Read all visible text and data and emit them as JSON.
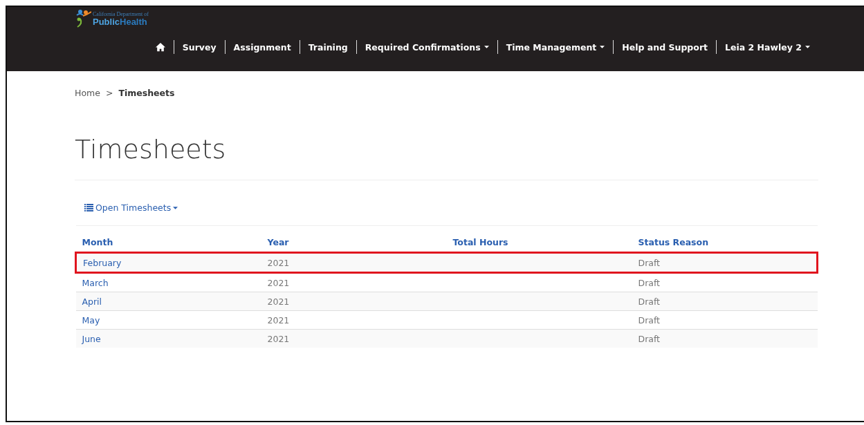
{
  "logo": {
    "subtitle": "California Department of",
    "title_part1": "Public",
    "title_part2": "Health"
  },
  "nav": [
    {
      "kind": "home"
    },
    {
      "kind": "link",
      "label": "Survey"
    },
    {
      "kind": "link",
      "label": "Assignment"
    },
    {
      "kind": "link",
      "label": "Training"
    },
    {
      "kind": "dropdown",
      "label": "Required Confirmations"
    },
    {
      "kind": "dropdown",
      "label": "Time Management"
    },
    {
      "kind": "link",
      "label": "Help and Support"
    },
    {
      "kind": "dropdown",
      "label": "Leia 2 Hawley 2"
    }
  ],
  "breadcrumb": [
    {
      "label": "Home",
      "current": false
    },
    {
      "label": "Timesheets",
      "current": true
    }
  ],
  "breadcrumb_separator": ">",
  "page_title": "Timesheets",
  "view_selector": {
    "label": "Open Timesheets"
  },
  "table": {
    "columns": [
      "Month",
      "Year",
      "Total Hours",
      "Status Reason"
    ],
    "rows": [
      {
        "month": "February",
        "year": "2021",
        "status": "Draft",
        "highlighted": true
      },
      {
        "month": "March",
        "year": "2021",
        "status": "Draft",
        "highlighted": false
      },
      {
        "month": "April",
        "year": "2021",
        "status": "Draft",
        "highlighted": false
      },
      {
        "month": "May",
        "year": "2021",
        "status": "Draft",
        "highlighted": false
      },
      {
        "month": "June",
        "year": "2021",
        "status": "Draft",
        "highlighted": false
      }
    ]
  }
}
